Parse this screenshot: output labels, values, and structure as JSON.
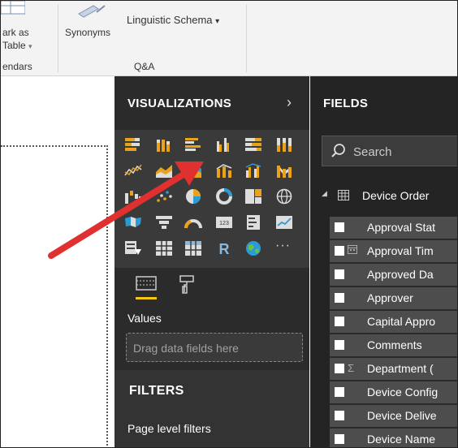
{
  "ribbon": {
    "mark_as_line1": "ark as",
    "mark_as_line2": "Table",
    "group_calendars": "endars",
    "synonyms_label": "Synonyms",
    "linguistic_schema_label": "Linguistic Schema",
    "group_qa": "Q&A"
  },
  "visualizations": {
    "title": "VISUALIZATIONS",
    "values_label": "Values",
    "drag_placeholder": "Drag data fields here",
    "filters_title": "FILTERS",
    "page_level_filters": "Page level filters"
  },
  "fields": {
    "title": "FIELDS",
    "search_placeholder": "Search",
    "table_name": "Device Order",
    "items": [
      {
        "name": "Approval Stat",
        "icon": ""
      },
      {
        "name": "Approval Tim",
        "icon": "calendar-icon"
      },
      {
        "name": "Approved Da",
        "icon": ""
      },
      {
        "name": "Approver",
        "icon": ""
      },
      {
        "name": "Capital Appro",
        "icon": ""
      },
      {
        "name": "Comments",
        "icon": ""
      },
      {
        "name": "Department (",
        "icon": "sigma-icon"
      },
      {
        "name": "Device Config",
        "icon": ""
      },
      {
        "name": "Device Delive",
        "icon": ""
      },
      {
        "name": "Device Name",
        "icon": ""
      }
    ]
  },
  "colors": {
    "accent_yellow": "#f2c811",
    "chart_orange": "#e8a21c",
    "chart_blue": "#2b9bd6",
    "arrow_red": "#e03030"
  }
}
